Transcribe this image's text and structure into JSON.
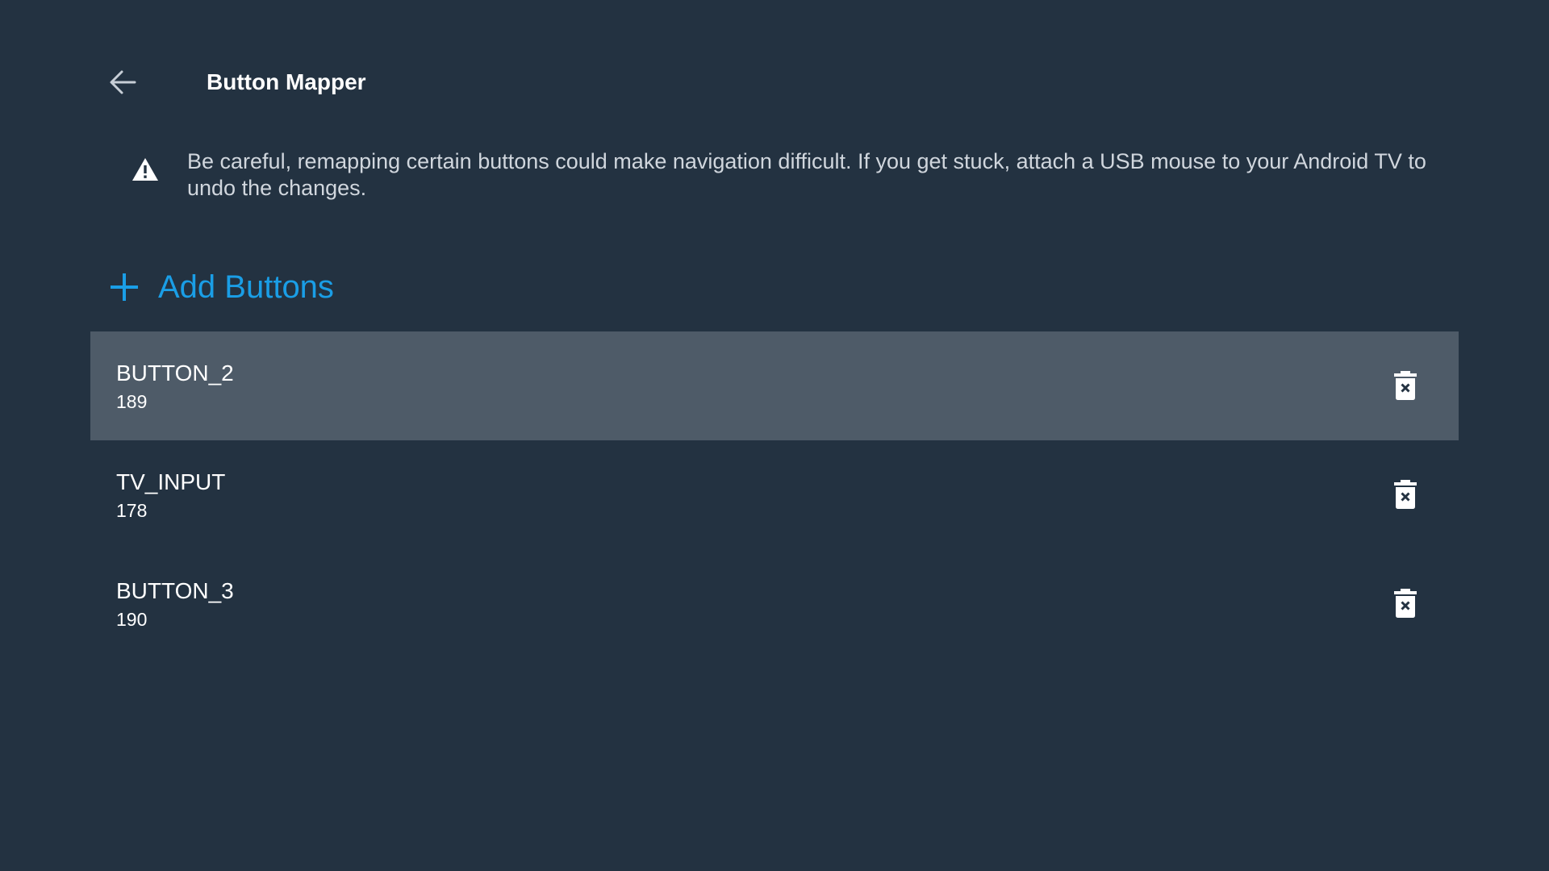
{
  "header": {
    "back_icon": "arrow-back-icon",
    "title": "Button Mapper"
  },
  "warning": {
    "icon": "warning-icon",
    "text": "Be careful, remapping certain buttons could make navigation difficult. If you get stuck, attach a USB mouse to your Android TV to undo the changes."
  },
  "add_buttons": {
    "icon": "plus-icon",
    "label": "Add Buttons"
  },
  "mapped_buttons": [
    {
      "name": "BUTTON_2",
      "code": "189",
      "focused": true,
      "delete_icon": "delete-icon"
    },
    {
      "name": "TV_INPUT",
      "code": "178",
      "focused": false,
      "delete_icon": "delete-icon"
    },
    {
      "name": "BUTTON_3",
      "code": "190",
      "focused": false,
      "delete_icon": "delete-icon"
    }
  ],
  "colors": {
    "background": "#233241",
    "focused_row": "#4e5b68",
    "accent": "#1a9ee6",
    "secondary_text": "#d0d6dd"
  }
}
